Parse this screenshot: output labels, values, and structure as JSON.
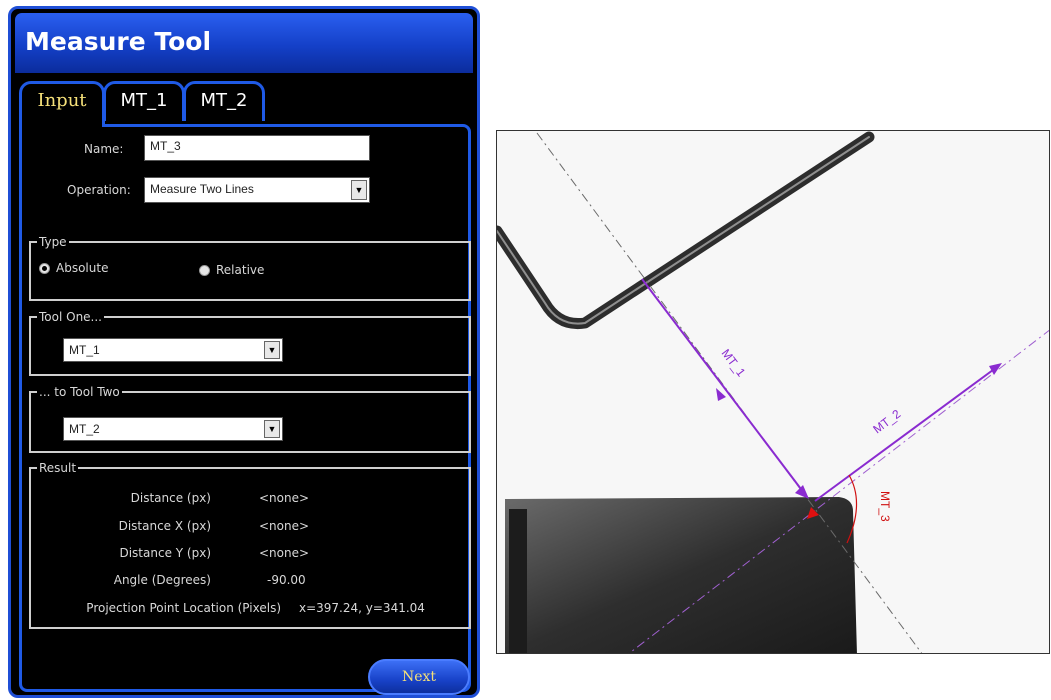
{
  "panel": {
    "title": "Measure Tool",
    "tabs": [
      {
        "label": "Input",
        "active": true
      },
      {
        "label": "MT_1",
        "active": false
      },
      {
        "label": "MT_2",
        "active": false
      }
    ],
    "name_label": "Name:",
    "name_value": "MT_3",
    "operation_label": "Operation:",
    "operation_value": "Measure Two Lines",
    "type": {
      "legend": "Type",
      "absolute_label": "Absolute",
      "relative_label": "Relative",
      "selected": "Absolute"
    },
    "tool_one": {
      "legend": "Tool One...",
      "value": "MT_1"
    },
    "tool_two": {
      "legend": "... to Tool Two",
      "value": "MT_2"
    },
    "result": {
      "legend": "Result",
      "rows": [
        {
          "label": "Distance   (px)",
          "value": "<none>"
        },
        {
          "label": "Distance X   (px)",
          "value": "<none>"
        },
        {
          "label": "Distance Y   (px)",
          "value": "<none>"
        },
        {
          "label": "Angle (Degrees)",
          "value": "-90.00"
        },
        {
          "label": "Projection Point Location (Pixels)",
          "value": "x=397.24, y=341.04"
        }
      ]
    },
    "next_label": "Next"
  },
  "view": {
    "labels": {
      "mt1": "MT_1",
      "mt2": "MT_2",
      "mt3": "MT_3"
    },
    "colors": {
      "measure_line": "#8a2bd0",
      "angle_arc": "#d01010",
      "point": "#e01010"
    }
  }
}
